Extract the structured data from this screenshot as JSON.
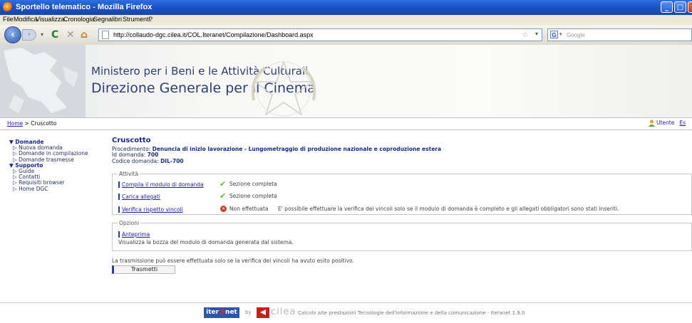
{
  "browser": {
    "title": "Sportello telematico - Mozilla Firefox",
    "menu": [
      "File",
      "Modifica",
      "Visualizza",
      "Cronologia",
      "Segnalibri",
      "Strumenti",
      "?"
    ],
    "url": "http://collaudo-dgc.cilea.it/COL.Iteranet/Compilazione/Dashboard.aspx",
    "search_placeholder": "Google",
    "titlebar_color": "#1a4fc4"
  },
  "banner": {
    "ministry": "Ministero per i Beni e le Attività Culturali",
    "department": "Direzione Generale per il Cinema",
    "text_color": "#2d3e74"
  },
  "breadcrumb": {
    "home": "Home",
    "separator": ">",
    "current": "Cruscotto"
  },
  "user": {
    "label": "Utente",
    "next_link": "Es"
  },
  "sidebar": {
    "groups": [
      {
        "label": "Domande",
        "items": [
          "Nuova domanda",
          "Domande in compilazione",
          "Domande trasmesse"
        ]
      },
      {
        "label": "Supporto",
        "items": [
          "Guide",
          "Contatti",
          "Requisiti browser",
          "Home DGC"
        ]
      }
    ]
  },
  "main": {
    "title": "Cruscotto",
    "procedimento_label": "Procedimento:",
    "procedimento_value": "Denuncia di inizio lavorazione - Lungometraggio di produzione nazionale e coproduzione estera",
    "id_label": "Id domanda:",
    "id_value": "700",
    "code_label": "Codice domanda:",
    "code_value": "DIL-700",
    "activities_legend": "Attività",
    "activities": [
      {
        "label": "Compila il modulo di domanda",
        "status": "Sezione completa",
        "state": "ok"
      },
      {
        "label": "Carica allegati",
        "status": "Sezione completa",
        "state": "ok"
      },
      {
        "label": "Verifica rispetto vincoli",
        "status": "Non effettuata",
        "state": "error",
        "note": "E' possibile effettuare la verifica dei vincoli solo se il modulo di domanda è completo e gli allegati obbligatori sono stati inseriti."
      }
    ],
    "options_legend": "Opzioni",
    "preview_label": "Anteprima",
    "preview_desc": "Visualizza la bozza del modulo di domanda generata dal sistema.",
    "transmit_note": "La trasmissione può essere effettuata solo se la verifica dei vincoli ha avuto esito positivo.",
    "transmit_button": "Trasmetti",
    "accent_color": "#1a2a8a",
    "ok_color": "#6cbe2c",
    "error_color": "#d83a2a"
  },
  "footer": {
    "brand_pre": "iter",
    "brand_at": "@",
    "brand_post": "net",
    "by": "by",
    "cilea": "cilea",
    "text": "Calcolo alte prestazioni Tecnologie dell'informazione e della comunicazione - Iteranet 1.9.0"
  }
}
